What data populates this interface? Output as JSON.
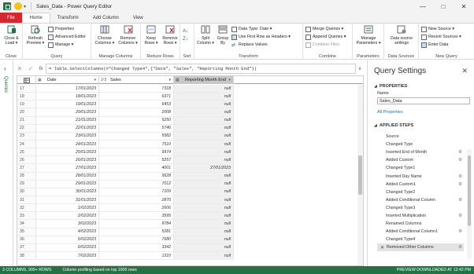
{
  "titlebar": {
    "title": "Sales_Data - Power Query Editor",
    "minimize": "—",
    "maximize": "□",
    "close": "✕"
  },
  "tabs": [
    "File",
    "Home",
    "Transform",
    "Add Column",
    "View"
  ],
  "ribbon": {
    "close": {
      "close_load": "Close &",
      "close_load2": "Load ▾",
      "group": "Close"
    },
    "query": {
      "refresh": "Refresh",
      "refresh2": "Preview ▾",
      "properties": "Properties",
      "advanced_editor": "Advanced Editor",
      "manage": "Manage ▾",
      "group": "Query"
    },
    "manage_columns": {
      "choose": "Choose",
      "choose2": "Columns ▾",
      "remove": "Remove",
      "remove2": "Columns ▾",
      "group": "Manage Columns"
    },
    "reduce_rows": {
      "keep": "Keep",
      "keep2": "Rows ▾",
      "remove": "Remove",
      "remove2": "Rows ▾",
      "group": "Reduce Rows"
    },
    "sort": {
      "group": "Sort"
    },
    "transform": {
      "split": "Split",
      "split2": "Column ▾",
      "groupby": "Group",
      "groupby2": "By",
      "data_type": "Data Type: Date ▾",
      "first_row": "Use First Row as Headers ▾",
      "replace": "Replace Values",
      "group": "Transform"
    },
    "combine": {
      "merge": "Merge Queries ▾",
      "append": "Append Queries ▾",
      "combine_files": "Combine Files",
      "group": "Combine"
    },
    "parameters": {
      "manage": "Manage",
      "manage2": "Parameters ▾",
      "group": "Parameters"
    },
    "data_sources": {
      "settings": "Data source",
      "settings2": "settings",
      "group": "Data Sources"
    },
    "new_query": {
      "new_source": "New Source ▾",
      "recent": "Recent Sources ▾",
      "enter": "Enter Data",
      "group": "New Query"
    }
  },
  "queries_pane": {
    "label": "Queries",
    "chevron": "›"
  },
  "formula": {
    "cancel": "✕",
    "commit": "✓",
    "fx": "fx",
    "text": "= Table.SelectColumns(#\"Changed Type4\",{\"Date\", \"Sales\", \"Reporting Month End\"})",
    "expand": "∨"
  },
  "grid": {
    "columns": [
      {
        "type_icon": "▦",
        "name": "Date"
      },
      {
        "type_icon": "1²3",
        "name": "Sales"
      },
      {
        "type_icon": "▦",
        "name": "Reporting Month End"
      }
    ],
    "rows": [
      [
        "17",
        "17/01/2023",
        "7318",
        "null"
      ],
      [
        "18",
        "18/01/2023",
        "6371",
        "null"
      ],
      [
        "19",
        "19/01/2023",
        "6453",
        "null"
      ],
      [
        "20",
        "20/01/2023",
        "2008",
        "null"
      ],
      [
        "21",
        "21/01/2023",
        "5250",
        "null"
      ],
      [
        "22",
        "22/01/2023",
        "5746",
        "null"
      ],
      [
        "23",
        "23/01/2023",
        "5582",
        "null"
      ],
      [
        "24",
        "24/01/2023",
        "7510",
        "null"
      ],
      [
        "25",
        "25/01/2023",
        "9974",
        "null"
      ],
      [
        "26",
        "26/01/2023",
        "5257",
        "null"
      ],
      [
        "27",
        "27/01/2023",
        "4001",
        "27/01/2023"
      ],
      [
        "28",
        "28/01/2023",
        "9528",
        "null"
      ],
      [
        "29",
        "29/01/2023",
        "7012",
        "null"
      ],
      [
        "30",
        "30/01/2023",
        "7109",
        "null"
      ],
      [
        "31",
        "31/01/2023",
        "2870",
        "null"
      ],
      [
        "32",
        "1/02/2023",
        "2606",
        "null"
      ],
      [
        "33",
        "2/02/2023",
        "3595",
        "null"
      ],
      [
        "34",
        "3/02/2023",
        "8784",
        "null"
      ],
      [
        "35",
        "4/02/2023",
        "5281",
        "null"
      ],
      [
        "36",
        "5/02/2023",
        "7680",
        "null"
      ],
      [
        "37",
        "6/02/2023",
        "3342",
        "null"
      ],
      [
        "38",
        "7/02/2023",
        "1310",
        "null"
      ]
    ]
  },
  "query_settings": {
    "title": "Query Settings",
    "close": "✕",
    "properties_header": "PROPERTIES",
    "name_label": "Name",
    "name_value": "Sales_Data",
    "all_properties": "All Properties",
    "applied_steps_header": "APPLIED STEPS",
    "steps": [
      {
        "label": "Source",
        "gear": false,
        "active": false
      },
      {
        "label": "Changed Type",
        "gear": false,
        "active": false
      },
      {
        "label": "Inserted End of Month",
        "gear": true,
        "active": false
      },
      {
        "label": "Added Custom",
        "gear": true,
        "active": false
      },
      {
        "label": "Changed Type1",
        "gear": false,
        "active": false
      },
      {
        "label": "Inserted Day Name",
        "gear": true,
        "active": false
      },
      {
        "label": "Added Custom1",
        "gear": true,
        "active": false
      },
      {
        "label": "Changed Type2",
        "gear": false,
        "active": false
      },
      {
        "label": "Added Conditional Column",
        "gear": true,
        "active": false
      },
      {
        "label": "Changed Type3",
        "gear": false,
        "active": false
      },
      {
        "label": "Inserted Multiplication",
        "gear": true,
        "active": false
      },
      {
        "label": "Renamed Columns",
        "gear": false,
        "active": false
      },
      {
        "label": "Added Conditional Column1",
        "gear": true,
        "active": false
      },
      {
        "label": "Changed Type4",
        "gear": false,
        "active": false
      },
      {
        "label": "Removed Other Columns",
        "gear": true,
        "active": true
      }
    ]
  },
  "statusbar": {
    "left": "3 COLUMNS, 999+ ROWS",
    "middle": "Column profiling based on top 1000 rows",
    "right": "PREVIEW DOWNLOADED AT 12:42 PM"
  },
  "colors": {
    "excel_green": "#217346",
    "file_red": "#d6262f",
    "link_blue": "#1a6fc0"
  }
}
